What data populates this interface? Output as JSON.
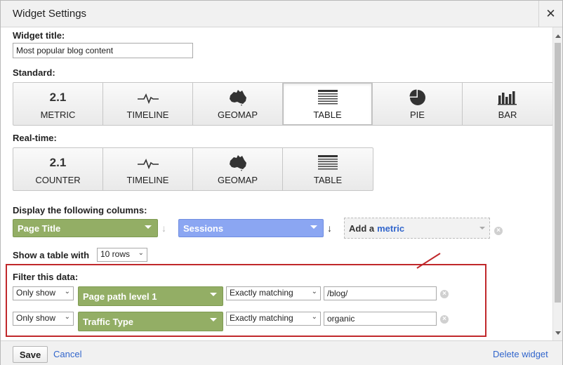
{
  "dialog": {
    "title": "Widget Settings"
  },
  "widget_title": {
    "label": "Widget title:",
    "value": "Most popular blog content"
  },
  "standard": {
    "label": "Standard:",
    "items": [
      {
        "label": "METRIC",
        "icon": "2.1"
      },
      {
        "label": "TIMELINE",
        "icon": "timeline-icon"
      },
      {
        "label": "GEOMAP",
        "icon": "australia-map-icon"
      },
      {
        "label": "TABLE",
        "icon": "table-icon",
        "selected": true
      },
      {
        "label": "PIE",
        "icon": "pie-icon"
      },
      {
        "label": "BAR",
        "icon": "bar-chart-icon"
      }
    ]
  },
  "realtime": {
    "label": "Real-time:",
    "items": [
      {
        "label": "COUNTER",
        "icon": "2.1"
      },
      {
        "label": "TIMELINE",
        "icon": "timeline-icon"
      },
      {
        "label": "GEOMAP",
        "icon": "australia-map-icon"
      },
      {
        "label": "TABLE",
        "icon": "table-icon"
      }
    ]
  },
  "columns": {
    "label": "Display the following columns:",
    "dimension": "Page Title",
    "metric": "Sessions",
    "add_prefix": "Add a",
    "add_metric_word": "metric",
    "x": "×"
  },
  "table_rows": {
    "label": "Show a table with",
    "value": "10 rows"
  },
  "filter": {
    "label": "Filter this data:",
    "rows": [
      {
        "mode": "Only show",
        "dimension": "Page path level 1",
        "match": "Exactly matching",
        "value": "/blog/"
      },
      {
        "mode": "Only show",
        "dimension": "Traffic Type",
        "match": "Exactly matching",
        "value": "organic"
      }
    ]
  },
  "footer": {
    "save": "Save",
    "cancel": "Cancel",
    "delete": "Delete widget"
  },
  "colors": {
    "dimension_pill": "#93ae65",
    "metric_pill": "#8ba6f2",
    "link": "#3266cc",
    "highlight": "#c0282b"
  }
}
